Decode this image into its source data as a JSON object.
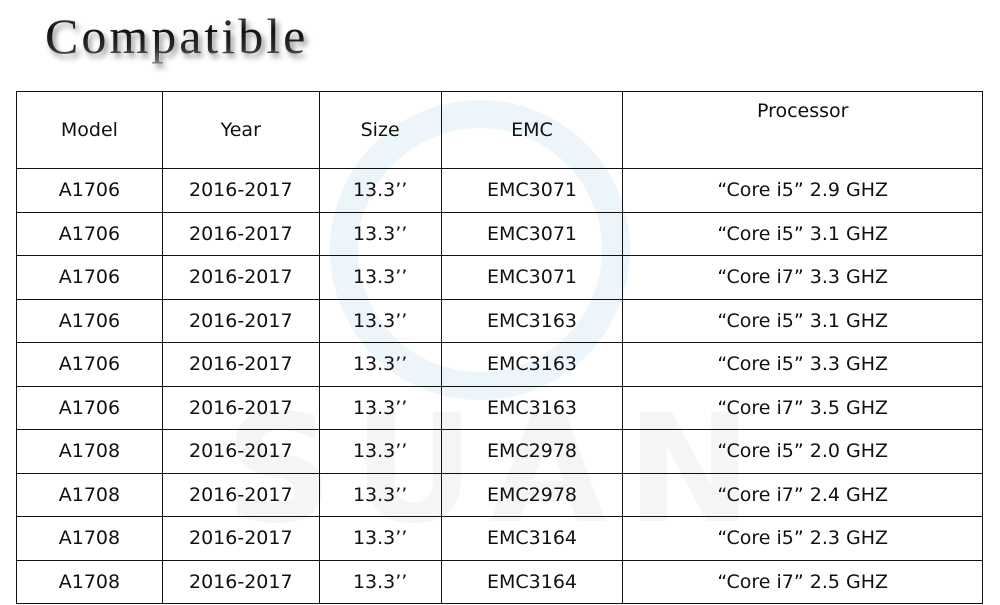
{
  "title": "Compatible",
  "watermark": "SUAN",
  "table": {
    "headers": [
      "Model",
      "Year",
      "Size",
      "EMC",
      "Processor"
    ],
    "rows": [
      [
        "A1706",
        "2016-2017",
        "13.3’’",
        "EMC3071",
        "“Core i5” 2.9 GHZ"
      ],
      [
        "A1706",
        "2016-2017",
        "13.3’’",
        "EMC3071",
        "“Core i5” 3.1 GHZ"
      ],
      [
        "A1706",
        "2016-2017",
        "13.3’’",
        "EMC3071",
        "“Core i7” 3.3 GHZ"
      ],
      [
        "A1706",
        "2016-2017",
        "13.3’’",
        "EMC3163",
        "“Core i5” 3.1 GHZ"
      ],
      [
        "A1706",
        "2016-2017",
        "13.3’’",
        "EMC3163",
        "“Core i5” 3.3 GHZ"
      ],
      [
        "A1706",
        "2016-2017",
        "13.3’’",
        "EMC3163",
        "“Core i7” 3.5 GHZ"
      ],
      [
        "A1708",
        "2016-2017",
        "13.3’’",
        "EMC2978",
        "“Core i5” 2.0 GHZ"
      ],
      [
        "A1708",
        "2016-2017",
        "13.3’’",
        "EMC2978",
        "“Core i7” 2.4 GHZ"
      ],
      [
        "A1708",
        "2016-2017",
        "13.3’’",
        "EMC3164",
        "“Core i5” 2.3 GHZ"
      ],
      [
        "A1708",
        "2016-2017",
        "13.3’’",
        "EMC3164",
        "“Core i7” 2.5 GHZ"
      ]
    ]
  }
}
